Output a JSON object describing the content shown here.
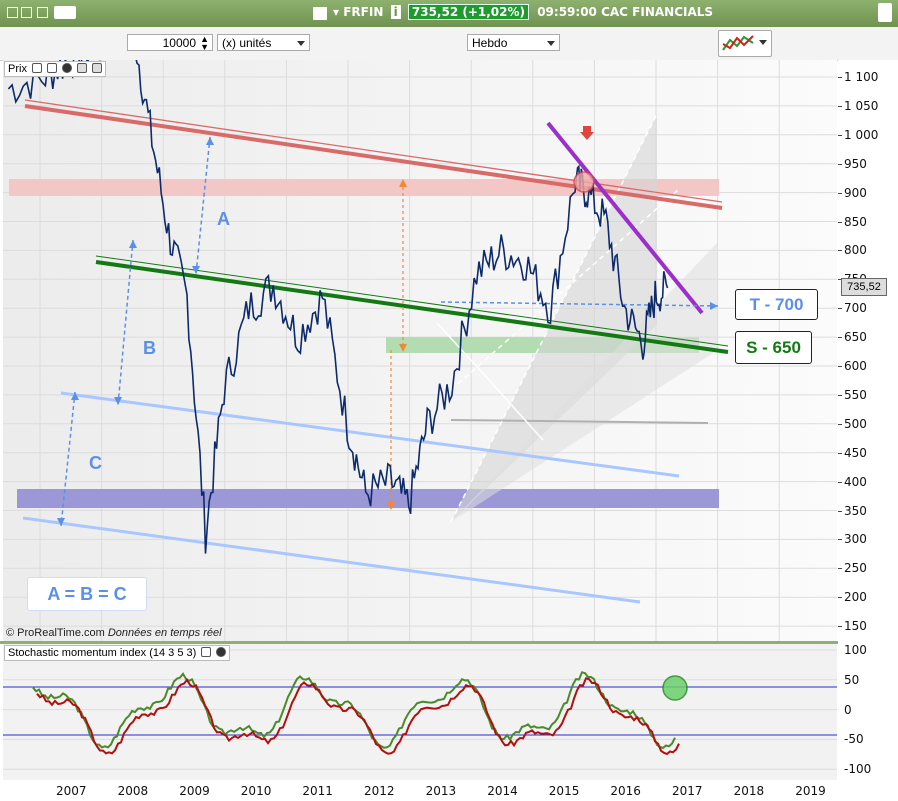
{
  "header": {
    "symbol": "FRFIN",
    "info_icon": "i",
    "price_badge": "735,52 (+1,02%)",
    "time_title": "09:59:00 CAC FINANCIALS"
  },
  "toolbar": {
    "quantity": "10000",
    "unit_label": "(x) unités",
    "period_label": "Hebdo"
  },
  "panels": {
    "price_label": "Prix",
    "indicator_label": "Stochastic momentum index (14 3 5 3)",
    "copyright": "© ProRealTime.com",
    "realtime_note": "Données en temps réel"
  },
  "annotations": {
    "A": "A",
    "B": "B",
    "C": "C",
    "equality": "A = B = C",
    "target": "T - 700",
    "support": "S - 650",
    "last_price": "735,52"
  },
  "colors": {
    "candle": "#0d2a6b",
    "resistance": "#d96a6a",
    "support_line": "#137a13",
    "purple_line": "#9a2fc9",
    "channel": "#a9c6ff",
    "dashed": "#5b8fe8",
    "orange": "#f0883a",
    "zone_red": "#f4c7c7",
    "zone_green": "#b3dcb0",
    "zone_purple": "#9c98d8",
    "stoch_green": "#4a8a2a",
    "stoch_red": "#b01010"
  },
  "chart_data": [
    {
      "type": "line",
      "x": [
        "2006.0",
        "2006.6",
        "2007.0",
        "2007.4",
        "2007.8",
        "2008.0",
        "2008.3",
        "2008.6",
        "2008.9",
        "2009.2",
        "2009.5",
        "2009.9",
        "2010.3",
        "2010.7",
        "2011.1",
        "2011.5",
        "2011.8",
        "2012.2",
        "2012.5",
        "2012.8",
        "2013.2",
        "2013.6",
        "2014.0",
        "2014.4",
        "2014.8",
        "2015.2",
        "2015.4",
        "2015.7",
        "2016.0",
        "2016.3",
        "2016.5",
        "2016.7"
      ],
      "series": [
        {
          "values": [
            1080,
            1100,
            1130,
            1150,
            1170,
            1200,
            1010,
            830,
            720,
            310,
            560,
            700,
            740,
            650,
            720,
            500,
            380,
            400,
            360,
            500,
            570,
            760,
            800,
            780,
            700,
            920,
            900,
            850,
            700,
            640,
            720,
            735
          ]
        }
      ],
      "ylim": [
        130,
        1120
      ],
      "yticks": [
        "1 100",
        "1 050",
        "1 000",
        "950",
        "900",
        "850",
        "800",
        "750",
        "700",
        "650",
        "600",
        "550",
        "500",
        "450",
        "400",
        "350",
        "300",
        "250",
        "200",
        "150"
      ]
    },
    {
      "type": "line",
      "ylim": [
        -100,
        100
      ],
      "yticks": [
        "100",
        "50",
        "0",
        "-50",
        "-100"
      ],
      "x": [
        "2007",
        "2008",
        "2009",
        "2010",
        "2011",
        "2012",
        "2013",
        "2014",
        "2015",
        "2016",
        "2017",
        "2018",
        "2019"
      ]
    }
  ],
  "xaxis": [
    "2007",
    "2008",
    "2009",
    "2010",
    "2011",
    "2012",
    "2013",
    "2014",
    "2015",
    "2016",
    "2017",
    "2018",
    "2019"
  ]
}
